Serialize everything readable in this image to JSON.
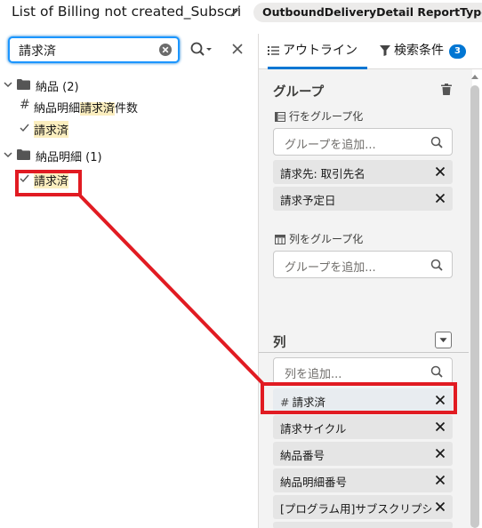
{
  "header": {
    "title": "List of Billing not created_Subscri",
    "report_type": "OutboundDeliveryDetail ReportType"
  },
  "left": {
    "search_value": "請求済",
    "tree": [
      {
        "kind": "folder",
        "label": "納品 (2)"
      },
      {
        "kind": "number",
        "prefix": "納品明細",
        "match": "請求済",
        "suffix": "件数"
      },
      {
        "kind": "text",
        "match": "請求済"
      },
      {
        "kind": "folder",
        "label": "納品明細 (1)"
      },
      {
        "kind": "text",
        "match": "請求済"
      }
    ]
  },
  "right": {
    "tabs": {
      "outline": "アウトライン",
      "filter": "検索条件",
      "filter_count": "3"
    },
    "group": {
      "title": "グループ",
      "row_label": "行をグループ化",
      "row_placeholder": "グループを追加...",
      "row_items": [
        "請求先: 取引先名",
        "請求予定日"
      ],
      "col_label": "列をグループ化",
      "col_placeholder": "グループを追加..."
    },
    "columns": {
      "title": "列",
      "placeholder": "列を追加...",
      "items": [
        {
          "label": "請求済",
          "number": true
        },
        {
          "label": "請求サイクル",
          "number": false
        },
        {
          "label": "納品番号",
          "number": false
        },
        {
          "label": "納品明細番号",
          "number": false
        },
        {
          "label": "[プログラム用]サブスクリプショ",
          "number": false
        }
      ]
    }
  },
  "colors": {
    "accent": "#0176d3",
    "highlight": "#fbeebf",
    "annotation": "#e11b22"
  }
}
